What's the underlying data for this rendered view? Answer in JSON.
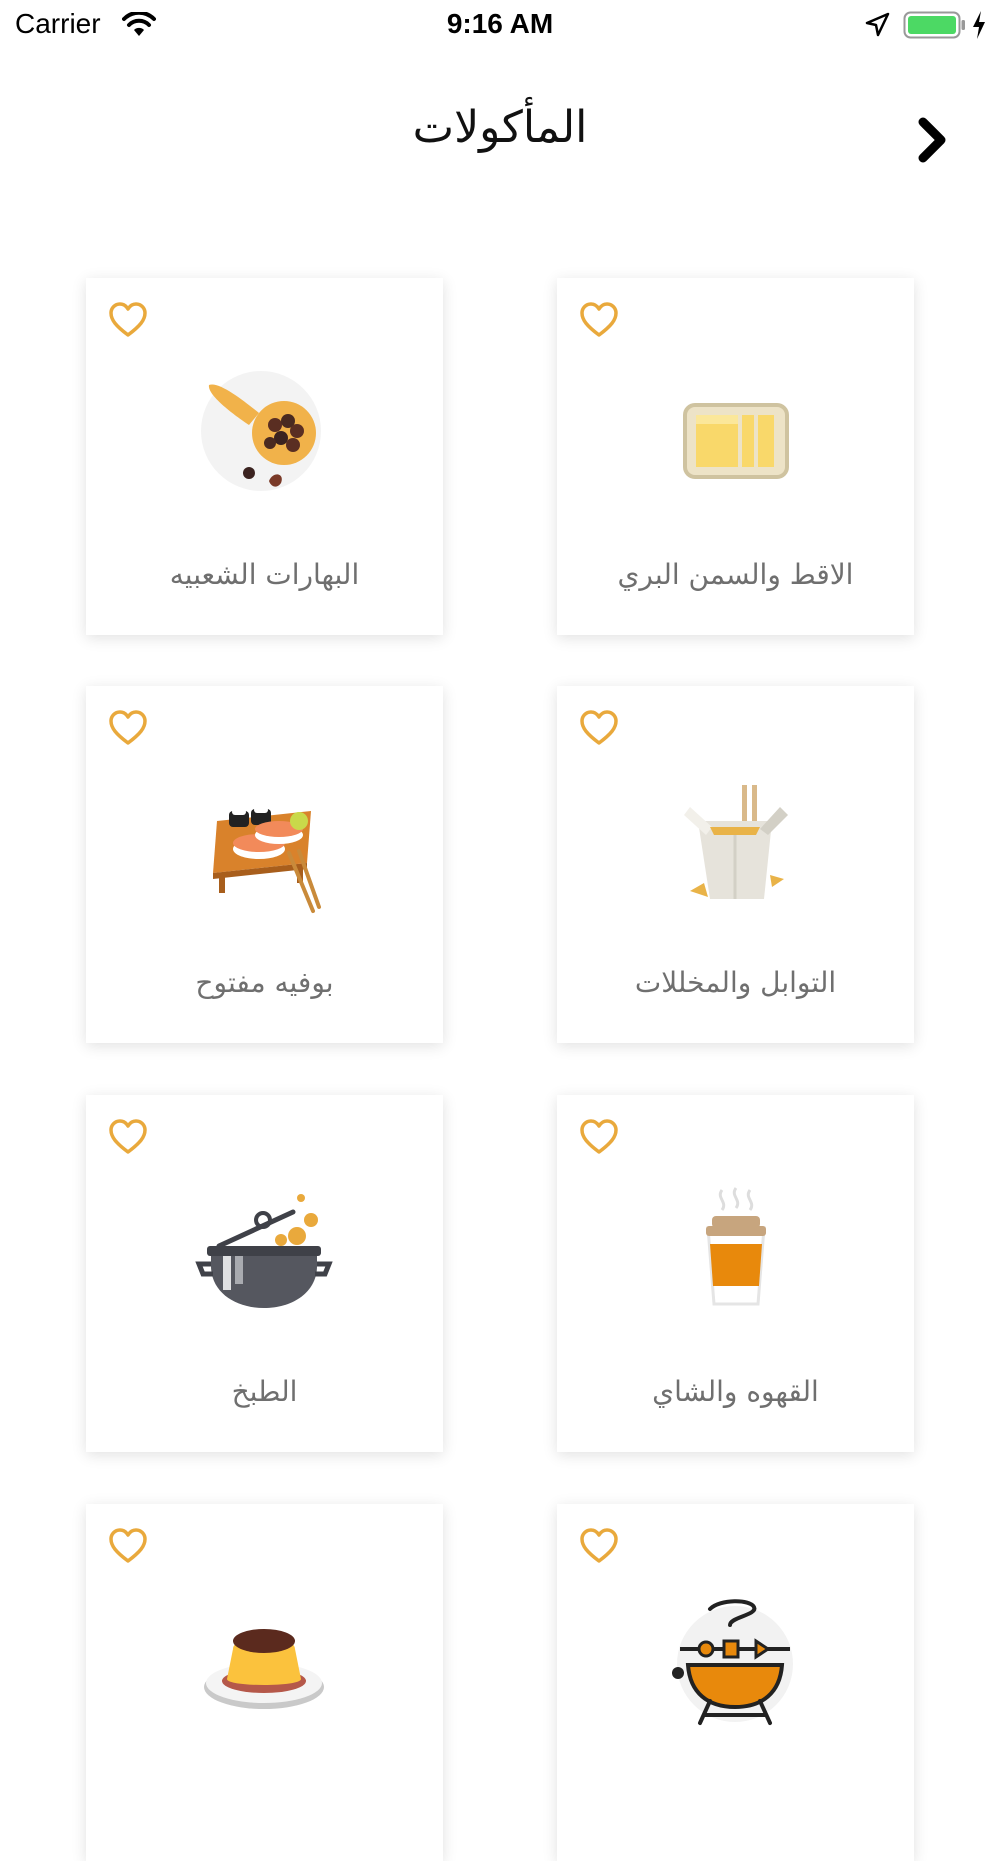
{
  "status_bar": {
    "carrier": "Carrier",
    "time": "9:16 AM"
  },
  "header": {
    "title": "المأكولات",
    "back_icon": "chevron-right-icon"
  },
  "colors": {
    "accent": "#E9A93C",
    "card_bg": "#FFFFFF",
    "label": "#6F6F6F",
    "battery": "#4CD964"
  },
  "categories": [
    {
      "label": "الاقط والسمن البري",
      "icon": "butter-icon"
    },
    {
      "label": "البهارات الشعبيه",
      "icon": "spices-spoon-icon"
    },
    {
      "label": "التوابل والمخللات",
      "icon": "takeout-box-icon"
    },
    {
      "label": "بوفيه مفتوح",
      "icon": "sushi-tray-icon"
    },
    {
      "label": "القهوه والشاي",
      "icon": "coffee-cup-icon"
    },
    {
      "label": "الطبخ",
      "icon": "cooking-pot-icon"
    },
    {
      "label": "",
      "icon": "grill-icon"
    },
    {
      "label": "",
      "icon": "pudding-icon"
    }
  ]
}
